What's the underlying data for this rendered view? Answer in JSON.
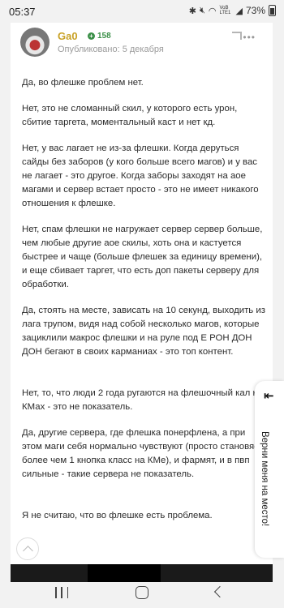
{
  "status_bar": {
    "time": "05:37",
    "network": "VoB LTE1",
    "battery": "73%",
    "icons": [
      "bluetooth-icon",
      "mute-icon",
      "wifi-icon",
      "signal-icon",
      "battery-icon"
    ]
  },
  "post": {
    "author": "Ga0",
    "reputation": "158",
    "published": "Опубликовано: 5 декабря",
    "paragraphs": [
      "Да, во флешке проблем нет.",
      "Нет, это не сломанный скил, у которого есть урон, сбитие таргета, моментальный каст и нет кд.",
      "Нет, у вас лагает не из-за флешки. Когда деруться сайды без заборов (у кого больше всего магов) и у вас не лагает - это другое. Когда заборы заходят на аое магами и сервер встает просто - это не имеет никакого отношения к флешке.",
      "Нет, спам флешки не нагружает сервер сервер больше, чем любые другие аое скилы, хоть она и кастуется быстрее и чаще (больше флешек за единицу времени), и еще сбивает таргет, что есть доп пакеты серверу для обработки.",
      "Да, стоять на месте, зависать на 10 секунд, выходить из лага трупом, видя над собой несколько магов, которые зациклили макрос флешки и на руле под Е РОН ДОН ДОН бегают в своих карманиах - это топ контент.",
      "Нет, то, что люди 2 года ругаются на флешочный кал на КМах - это не показатель.",
      "Да, другие сервера, где флешка понерфлена, а при этом маги себя нормально чувствуют (просто становясь более чем 1 кнопка класс на КМе), и фармят, и в пвп сильные - такие сервера не показатель.",
      "Я не считаю, что во флешке есть проблема."
    ]
  },
  "edge_panel": {
    "label": "Верни меня на место!",
    "arrow": "⇤"
  },
  "colors": {
    "author": "#c9a227",
    "reputation": "#3a8f47",
    "meta": "#9b9b9b"
  }
}
